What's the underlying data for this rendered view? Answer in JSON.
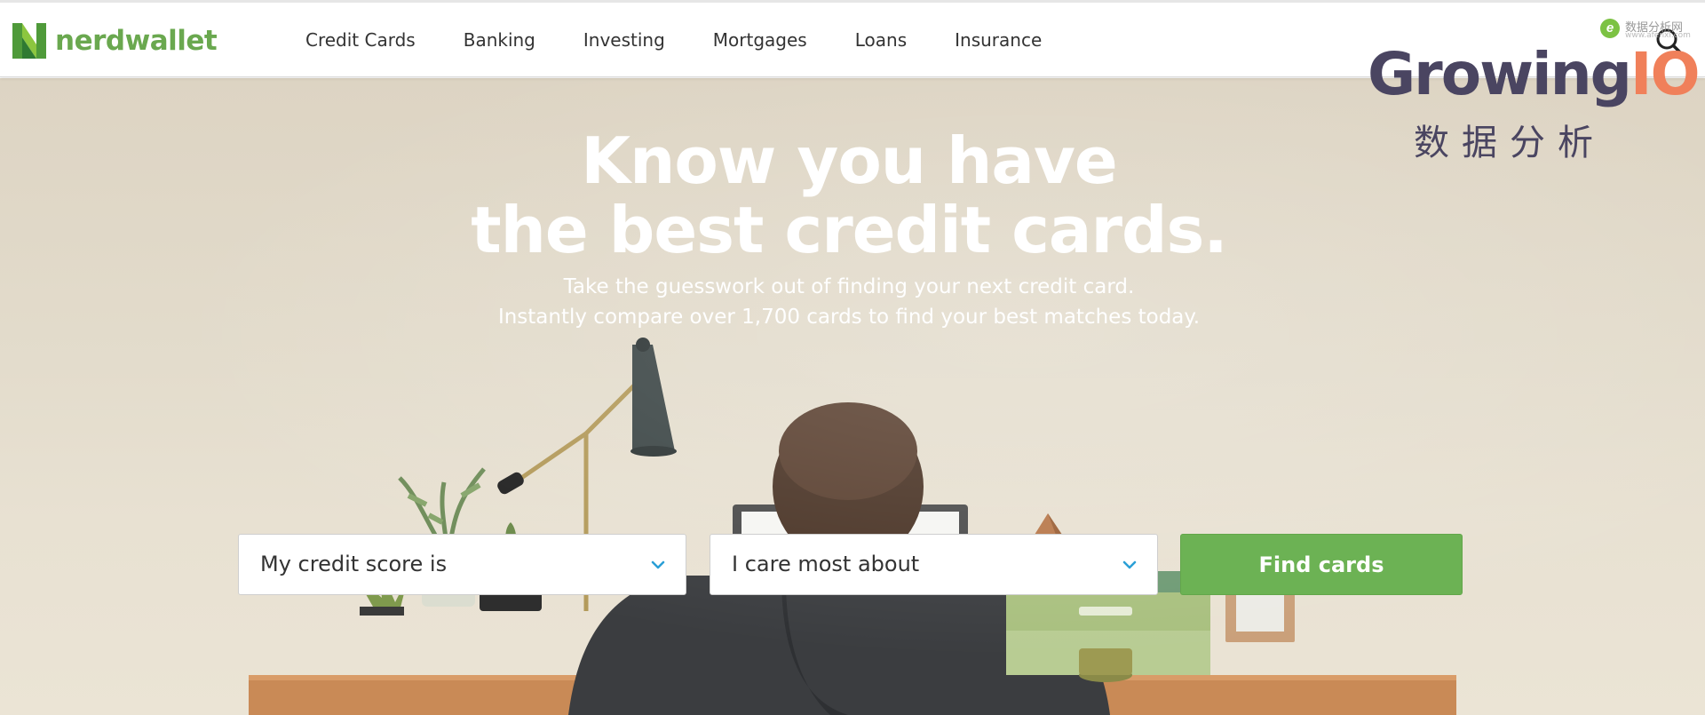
{
  "header": {
    "brand": "nerdwallet",
    "nav": [
      "Credit Cards",
      "Banking",
      "Investing",
      "Mortgages",
      "Loans",
      "Insurance"
    ],
    "search_icon": "search-icon"
  },
  "hero": {
    "headline_line1": "Know you have",
    "headline_line2": "the best credit cards.",
    "sub_line1": "Take the guesswork out of finding your next credit card.",
    "sub_line2": "Instantly compare over 1,700 cards to find your best matches today."
  },
  "form": {
    "credit_score_select": "My credit score is",
    "priority_select": "I care most about",
    "submit_label": "Find cards"
  },
  "watermarks": {
    "growing_main": "Growing",
    "growing_io": "IO",
    "growing_cn": "数据分析",
    "site_cn": "数据分析网",
    "site_url": "www.afenxi.com"
  },
  "colors": {
    "brand_green": "#6aa84f",
    "button_green": "#6cb254",
    "chevron_blue": "#2a9fd6",
    "nav_text": "#333333"
  }
}
